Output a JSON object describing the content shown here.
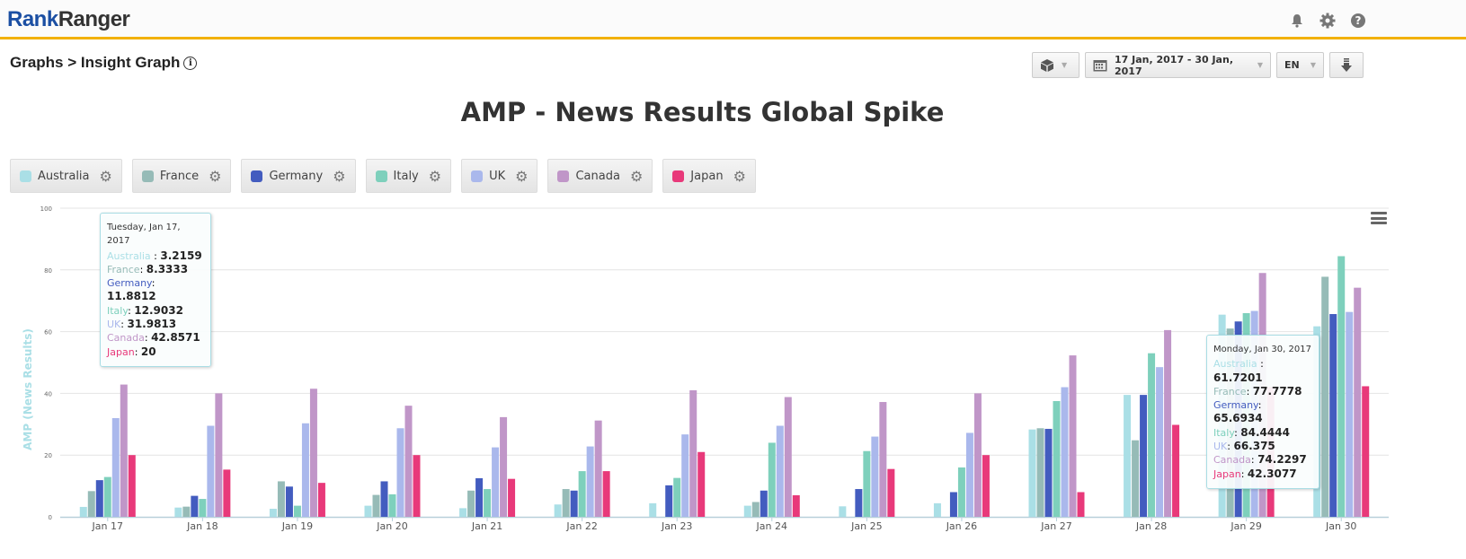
{
  "app": {
    "logo_part1": "Rank",
    "logo_part2": "Ranger",
    "icons": [
      "bell-icon",
      "gear-icon",
      "help-icon"
    ]
  },
  "breadcrumb": {
    "text": "Graphs > Insight Graph",
    "info_icon": "i"
  },
  "toolbar": {
    "view_icon": "cube-icon",
    "date_range": "17 Jan, 2017 - 30 Jan, 2017",
    "language": "EN",
    "download_icon": "download-icon",
    "caret": "▼"
  },
  "colors": {
    "accent_bar": "#f2b100",
    "logo_blue": "#1b4fa3"
  },
  "chart_data": {
    "type": "bar",
    "title": "AMP - News Results Global Spike",
    "xlabel": "",
    "ylabel": "AMP (News Results)",
    "ylim": [
      0,
      100
    ],
    "yticks": [
      "0",
      "20",
      "40",
      "60",
      "80",
      "100"
    ],
    "grid": true,
    "legend_placement": "top-left",
    "categories": [
      "Jan 17",
      "Jan 18",
      "Jan 19",
      "Jan 20",
      "Jan 21",
      "Jan 22",
      "Jan 23",
      "Jan 24",
      "Jan 25",
      "Jan 26",
      "Jan 27",
      "Jan 28",
      "Jan 29",
      "Jan 30"
    ],
    "series": [
      {
        "name": "Australia",
        "color": "#aadfe6",
        "values": [
          3.2159,
          3.0,
          2.6,
          3.6,
          2.8,
          4.0,
          4.4,
          3.6,
          3.4,
          4.4,
          28.3,
          39.5,
          65.5,
          61.7201
        ]
      },
      {
        "name": "France",
        "color": "#96bbb7",
        "values": [
          8.3333,
          3.3,
          11.5,
          7.1,
          8.5,
          9.0,
          0,
          4.8,
          0,
          0,
          28.7,
          24.8,
          61.0,
          77.7778
        ]
      },
      {
        "name": "Germany",
        "color": "#435cbf",
        "values": [
          11.8812,
          6.8,
          9.8,
          11.5,
          12.5,
          8.5,
          10.2,
          8.5,
          9.0,
          8.0,
          28.5,
          39.5,
          63.3,
          65.6934
        ]
      },
      {
        "name": "Italy",
        "color": "#7ed0bc",
        "values": [
          12.9032,
          5.8,
          3.6,
          7.3,
          9.0,
          14.8,
          12.6,
          24.0,
          21.3,
          16.0,
          37.5,
          53.0,
          66.0,
          84.4444
        ]
      },
      {
        "name": "UK",
        "color": "#aab8ec",
        "values": [
          31.9813,
          29.5,
          30.3,
          28.7,
          22.5,
          22.8,
          26.7,
          29.5,
          26.0,
          27.2,
          42.0,
          48.5,
          66.7,
          66.375
        ]
      },
      {
        "name": "Canada",
        "color": "#c096c8",
        "values": [
          42.8571,
          40.0,
          41.5,
          36.0,
          32.3,
          31.2,
          41.0,
          38.8,
          37.2,
          40.0,
          52.3,
          60.5,
          79.0,
          74.2297
        ]
      },
      {
        "name": "Japan",
        "color": "#e8397a",
        "values": [
          20,
          15.3,
          11.0,
          20.0,
          12.3,
          14.8,
          21.0,
          7.0,
          15.5,
          20.0,
          8.0,
          29.8,
          42.0,
          42.3077
        ]
      }
    ],
    "tooltips": [
      {
        "date": "Tuesday, Jan 17, 2017",
        "rows": [
          {
            "name": "Australia ",
            "value": "3.2159"
          },
          {
            "name": "France",
            "value": "8.3333"
          },
          {
            "name": "Germany",
            "value": "11.8812"
          },
          {
            "name": "Italy",
            "value": "12.9032"
          },
          {
            "name": "UK",
            "value": "31.9813"
          },
          {
            "name": "Canada",
            "value": "42.8571"
          },
          {
            "name": "Japan",
            "value": "20"
          }
        ]
      },
      {
        "date": "Monday, Jan 30, 2017",
        "rows": [
          {
            "name": "Australia ",
            "value": "61.7201"
          },
          {
            "name": "France",
            "value": "77.7778"
          },
          {
            "name": "Germany",
            "value": "65.6934"
          },
          {
            "name": "Italy",
            "value": "84.4444"
          },
          {
            "name": "UK",
            "value": "66.375"
          },
          {
            "name": "Canada",
            "value": "74.2297"
          },
          {
            "name": "Japan",
            "value": "42.3077"
          }
        ]
      }
    ]
  }
}
